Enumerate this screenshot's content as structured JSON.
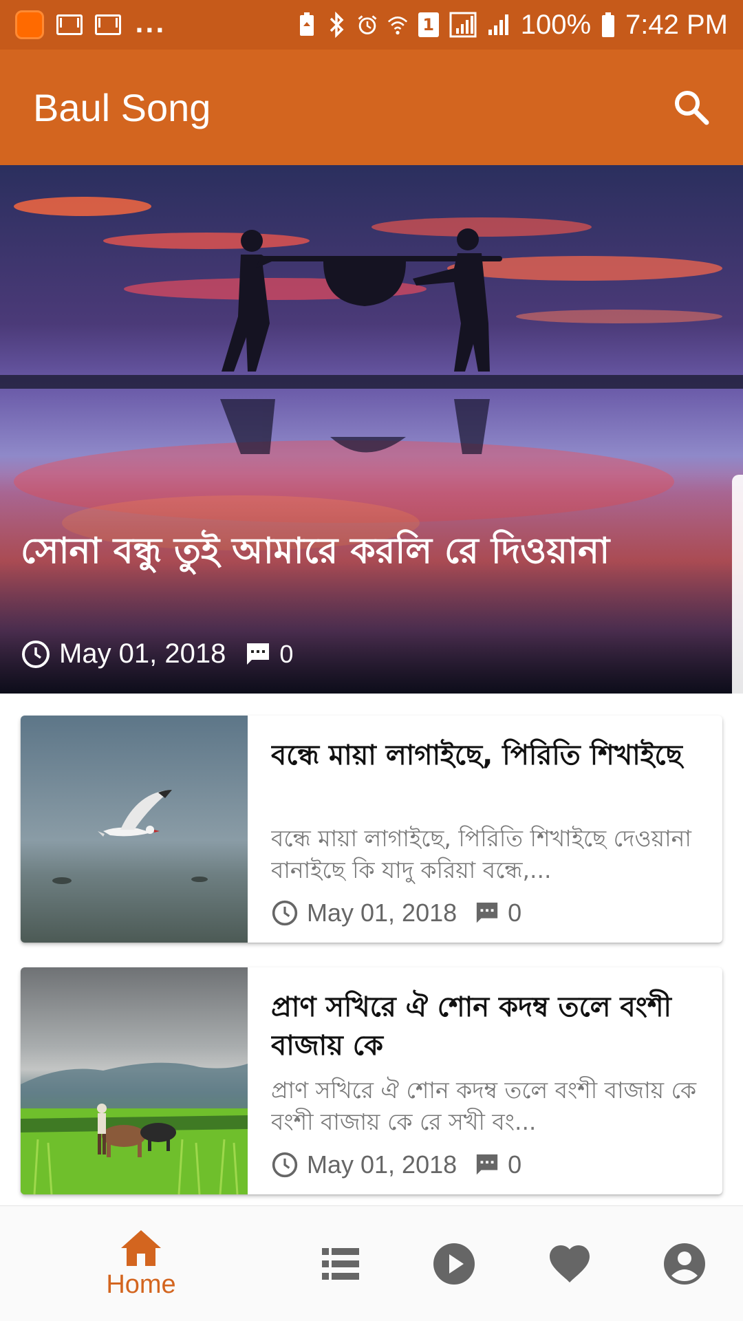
{
  "status_bar": {
    "more": "...",
    "battery": "100%",
    "time": "7:42 PM",
    "sim_number": "1",
    "icons": [
      "app-icon",
      "mail-icon",
      "mail-icon",
      "battery-saver-icon",
      "bluetooth-icon",
      "alarm-icon",
      "wifi-icon",
      "signal-icon",
      "signal-icon",
      "battery-icon"
    ]
  },
  "appbar": {
    "title": "Baul Song",
    "search_icon": "search-icon",
    "color": "#d3651f"
  },
  "hero": {
    "title": "সোনা বন্ধু তুই আমারে করলি রে দিওয়ানা",
    "date": "May 01, 2018",
    "comments": "0"
  },
  "posts": [
    {
      "title": "বন্ধে মায়া লাগাইছে, পিরিতি শিখাইছে",
      "excerpt": "বন্ধে মায়া লাগাইছে, পিরিতি শিখাইছে দেওয়ানা বানাইছে   কি যাদু করিয়া বন্ধে,...",
      "date": "May 01, 2018",
      "comments": "0"
    },
    {
      "title": "প্রাণ সখিরে ঐ শোন কদম্ব তলে বংশী বাজায় কে",
      "excerpt": "প্রাণ সখিরে   ঐ শোন কদম্ব তলে বংশী বাজায় কে  বংশী বাজায় কে রে সখী বং...",
      "date": "May 01, 2018",
      "comments": "0"
    }
  ],
  "bottom_nav": {
    "home_label": "Home",
    "items": [
      "home-icon",
      "list-icon",
      "play-icon",
      "heart-icon",
      "account-icon"
    ],
    "active_color": "#d3651f",
    "inactive_color": "#666666"
  }
}
